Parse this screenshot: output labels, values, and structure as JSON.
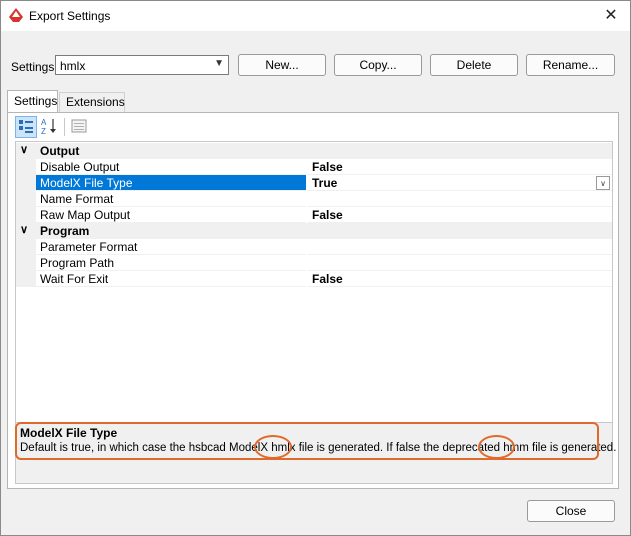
{
  "window": {
    "title": "Export Settings",
    "close_glyph": "✕"
  },
  "settings_row": {
    "label": "Settings",
    "selected": "hmlx",
    "buttons": {
      "new": "New...",
      "copy": "Copy...",
      "delete": "Delete",
      "rename": "Rename..."
    }
  },
  "tabs": [
    {
      "label": "Settings",
      "active": true
    },
    {
      "label": "Extensions",
      "active": false
    }
  ],
  "grid": {
    "categories": [
      {
        "label": "Output",
        "properties": [
          {
            "name": "Disable Output",
            "value": "False"
          },
          {
            "name": "ModelX File Type",
            "value": "True",
            "selected": true
          },
          {
            "name": "Name Format",
            "value": ""
          },
          {
            "name": "Raw Map Output",
            "value": "False"
          }
        ]
      },
      {
        "label": "Program",
        "properties": [
          {
            "name": "Parameter Format",
            "value": ""
          },
          {
            "name": "Program Path",
            "value": ""
          },
          {
            "name": "Wait For Exit",
            "value": "False"
          }
        ]
      }
    ]
  },
  "description": {
    "title": "ModelX File Type",
    "text": "Default is true, in which case the hsbcad ModelX hmlx file is generated. If false the deprecated hmm file is generated."
  },
  "footer": {
    "close": "Close"
  },
  "colors": {
    "selection": "#0078d7",
    "annotation": "#e06a2c"
  }
}
